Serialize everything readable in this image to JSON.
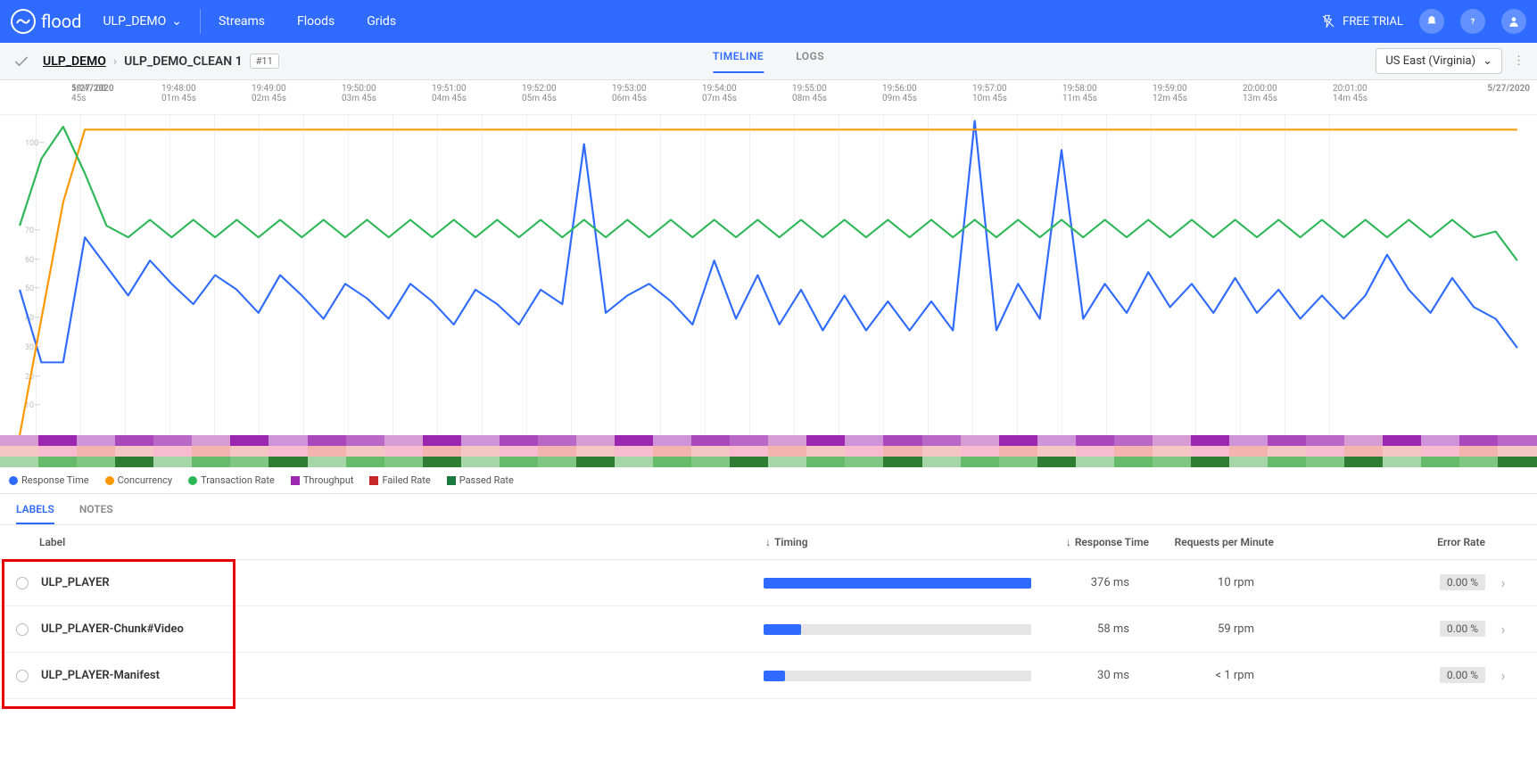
{
  "header": {
    "brand": "flood",
    "project": "ULP_DEMO",
    "nav": [
      "Streams",
      "Floods",
      "Grids"
    ],
    "trial": "FREE TRIAL"
  },
  "breadcrumb": {
    "root": "ULP_DEMO",
    "current": "ULP_DEMO_CLEAN 1",
    "run_badge": "#11"
  },
  "subtabs": {
    "timeline": "TIMELINE",
    "logs": "LOGS"
  },
  "region": "US East (Virginia)",
  "time_axis": {
    "date": "5/27/2020",
    "start_sub": "45s",
    "ticks": [
      {
        "t": "19:47:00",
        "s": "45s"
      },
      {
        "t": "19:48:00",
        "s": "01m 45s"
      },
      {
        "t": "19:49:00",
        "s": "02m 45s"
      },
      {
        "t": "19:50:00",
        "s": "03m 45s"
      },
      {
        "t": "19:51:00",
        "s": "04m 45s"
      },
      {
        "t": "19:52:00",
        "s": "05m 45s"
      },
      {
        "t": "19:53:00",
        "s": "06m 45s"
      },
      {
        "t": "19:54:00",
        "s": "07m 45s"
      },
      {
        "t": "19:55:00",
        "s": "08m 45s"
      },
      {
        "t": "19:56:00",
        "s": "09m 45s"
      },
      {
        "t": "19:57:00",
        "s": "10m 45s"
      },
      {
        "t": "19:58:00",
        "s": "11m 45s"
      },
      {
        "t": "19:59:00",
        "s": "12m 45s"
      },
      {
        "t": "20:00:00",
        "s": "13m 45s"
      },
      {
        "t": "20:01:00",
        "s": "14m 45s"
      }
    ],
    "end_date": "5/27/2020"
  },
  "chart_data": {
    "type": "line",
    "ylabel": "",
    "ylim": [
      0,
      110
    ],
    "y_ticks": [
      10,
      20,
      30,
      40,
      50,
      60,
      70,
      100
    ],
    "x_ticks": [
      "19:48:00",
      "19:49:00",
      "19:50:00",
      "19:51:00",
      "19:52:00",
      "19:53:00",
      "19:54:00",
      "19:55:00",
      "19:56:00",
      "19:57:00",
      "19:58:00",
      "19:59:00",
      "20:00:00",
      "20:01:00"
    ],
    "series": [
      {
        "name": "Response Time",
        "color": "#2f6bff",
        "values": [
          50,
          25,
          25,
          68,
          58,
          48,
          60,
          52,
          45,
          55,
          50,
          42,
          55,
          48,
          40,
          52,
          47,
          40,
          52,
          46,
          38,
          50,
          45,
          38,
          50,
          45,
          100,
          42,
          48,
          52,
          46,
          38,
          60,
          40,
          55,
          38,
          50,
          36,
          48,
          36,
          46,
          36,
          46,
          36,
          108,
          36,
          52,
          40,
          98,
          40,
          52,
          42,
          56,
          44,
          52,
          42,
          54,
          42,
          50,
          40,
          48,
          40,
          48,
          62,
          50,
          42,
          54,
          44,
          40,
          30
        ]
      },
      {
        "name": "Concurrency",
        "color": "#ff9800",
        "values": [
          0,
          40,
          80,
          105,
          105,
          105,
          105,
          105,
          105,
          105,
          105,
          105,
          105,
          105,
          105,
          105,
          105,
          105,
          105,
          105,
          105,
          105,
          105,
          105,
          105,
          105,
          105,
          105,
          105,
          105,
          105,
          105,
          105,
          105,
          105,
          105,
          105,
          105,
          105,
          105,
          105,
          105,
          105,
          105,
          105,
          105,
          105,
          105,
          105,
          105,
          105,
          105,
          105,
          105,
          105,
          105,
          105,
          105,
          105,
          105,
          105,
          105,
          105,
          105,
          105,
          105,
          105,
          105,
          105,
          105
        ]
      },
      {
        "name": "Transaction Rate",
        "color": "#2db757",
        "values": [
          72,
          95,
          106,
          90,
          72,
          68,
          74,
          68,
          74,
          68,
          74,
          68,
          74,
          68,
          74,
          68,
          74,
          68,
          74,
          68,
          74,
          68,
          74,
          68,
          74,
          68,
          74,
          68,
          74,
          68,
          74,
          68,
          74,
          68,
          74,
          68,
          74,
          68,
          74,
          68,
          74,
          68,
          74,
          68,
          74,
          68,
          74,
          68,
          74,
          68,
          74,
          68,
          74,
          68,
          74,
          68,
          74,
          68,
          74,
          68,
          74,
          68,
          74,
          68,
          74,
          68,
          74,
          68,
          70,
          60
        ]
      }
    ]
  },
  "legend": [
    {
      "label": "Response Time",
      "color": "#2f6bff",
      "shape": "dot"
    },
    {
      "label": "Concurrency",
      "color": "#ff9800",
      "shape": "dot"
    },
    {
      "label": "Transaction Rate",
      "color": "#2db757",
      "shape": "dot"
    },
    {
      "label": "Throughput",
      "color": "#9b27b0",
      "shape": "sq"
    },
    {
      "label": "Failed Rate",
      "color": "#c62828",
      "shape": "sq"
    },
    {
      "label": "Passed Rate",
      "color": "#1b7a3f",
      "shape": "sq"
    }
  ],
  "bottom_tabs": {
    "labels": "LABELS",
    "notes": "NOTES"
  },
  "table": {
    "headers": {
      "label": "Label",
      "timing": "Timing",
      "rt": "Response Time",
      "rpm": "Requests per Minute",
      "err": "Error Rate"
    },
    "rows": [
      {
        "name": "ULP_PLAYER",
        "timing_pct": 100,
        "rt": "376 ms",
        "rpm": "10 rpm",
        "err": "0.00 %"
      },
      {
        "name": "ULP_PLAYER-Chunk#Video",
        "timing_pct": 14,
        "rt": "58 ms",
        "rpm": "59 rpm",
        "err": "0.00 %"
      },
      {
        "name": "ULP_PLAYER-Manifest",
        "timing_pct": 8,
        "rt": "30 ms",
        "rpm": "< 1 rpm",
        "err": "0.00 %"
      }
    ]
  }
}
